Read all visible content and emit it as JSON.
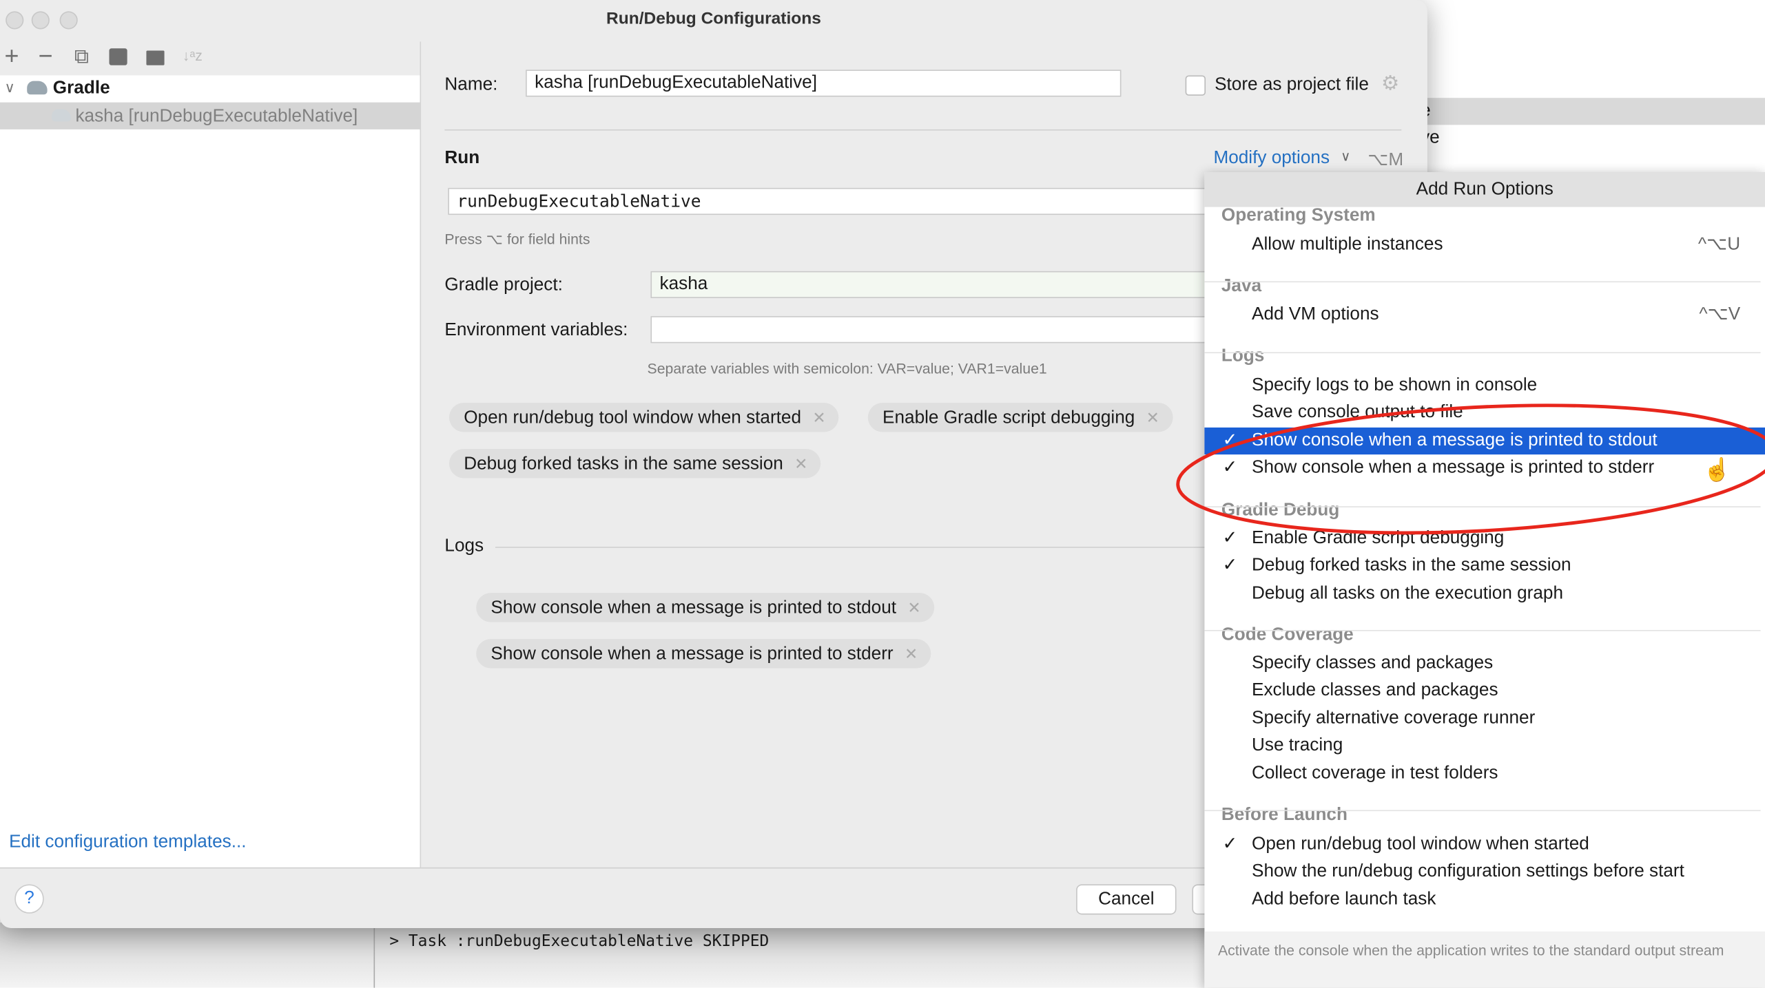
{
  "background": {
    "row_fragment_1": "e",
    "row_fragment_2": "ve",
    "console_line": "> Task :runDebugExecutableNative SKIPPED"
  },
  "dialog": {
    "title": "Run/Debug Configurations",
    "toolbar": {
      "add": "+",
      "remove": "−",
      "copy": "⧉",
      "save": "🖫",
      "new_folder": "📁",
      "sort": "↓ᵃz"
    },
    "tree": {
      "group": "Gradle",
      "item": "kasha [runDebugExecutableNative]"
    },
    "edit_templates_link": "Edit configuration templates...",
    "name_label": "Name:",
    "name_value": "kasha [runDebugExecutableNative]",
    "store_label": "Store as project file",
    "store_checked": false,
    "run_heading": "Run",
    "modify_options": "Modify options",
    "modify_shortcut": "⌥M",
    "run_value": "runDebugExecutableNative",
    "run_hint": "Press ⌥ for field hints",
    "gradle_project_label": "Gradle project:",
    "gradle_project_value": "kasha",
    "env_label": "Environment variables:",
    "env_value": "",
    "env_hint": "Separate variables with semicolon: VAR=value; VAR1=value1",
    "chips": [
      "Open run/debug tool window when started",
      "Enable Gradle script debugging",
      "Debug forked tasks in the same session"
    ],
    "logs_heading": "Logs",
    "log_chips": [
      "Show console when a message is printed to stdout",
      "Show console when a message is printed to stderr"
    ],
    "help": "?",
    "cancel": "Cancel"
  },
  "popup": {
    "title": "Add Run Options",
    "sections": {
      "os": "Operating System",
      "java": "Java",
      "logs": "Logs",
      "gradle_debug": "Gradle Debug",
      "coverage": "Code Coverage",
      "before_launch": "Before Launch"
    },
    "items": [
      {
        "label": "Allow multiple instances",
        "shortcut": "^⌥U",
        "checked": false
      },
      {
        "label": "Add VM options",
        "shortcut": "^⌥V",
        "checked": false
      },
      {
        "label": "Specify logs to be shown in console",
        "checked": false
      },
      {
        "label": "Save console output to file",
        "checked": false
      },
      {
        "label": "Show console when a message is printed to stdout",
        "checked": true,
        "selected": true
      },
      {
        "label": "Show console when a message is printed to stderr",
        "checked": true
      },
      {
        "label": "Enable Gradle script debugging",
        "checked": true
      },
      {
        "label": "Debug forked tasks in the same session",
        "checked": true
      },
      {
        "label": "Debug all tasks on the execution graph",
        "checked": false
      },
      {
        "label": "Specify classes and packages",
        "checked": false
      },
      {
        "label": "Exclude classes and packages",
        "checked": false
      },
      {
        "label": "Specify alternative coverage runner",
        "checked": false
      },
      {
        "label": "Use tracing",
        "checked": false
      },
      {
        "label": "Collect coverage in test folders",
        "checked": false
      },
      {
        "label": "Open run/debug tool window when started",
        "checked": true
      },
      {
        "label": "Show the run/debug configuration settings before start",
        "checked": false
      },
      {
        "label": "Add before launch task",
        "checked": false
      }
    ],
    "check_glyph": "✓",
    "description": "Activate the console when the application writes to the standard output stream"
  },
  "colors": {
    "accent_link": "#2470c2",
    "selection": "#1a5fd6",
    "annotation": "#e8261c"
  }
}
